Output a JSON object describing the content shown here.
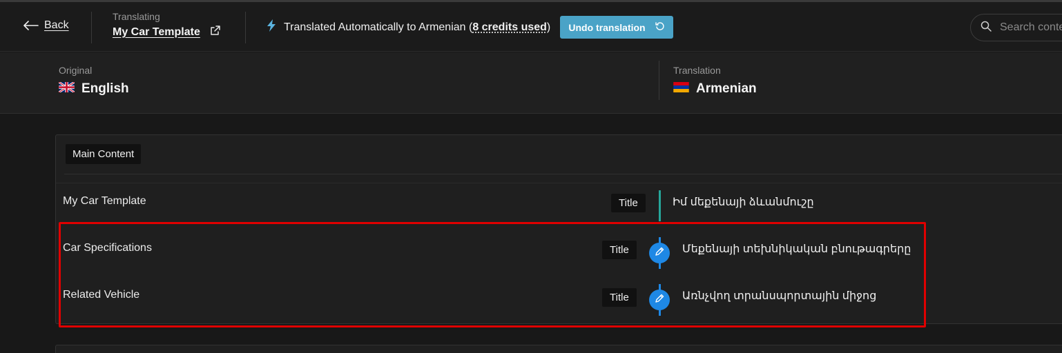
{
  "header": {
    "back_label": "Back",
    "translating_label": "Translating",
    "document_title": "My Car Template",
    "status_text": "Translated Automatically to Armenian (",
    "status_credits": "8 credits used",
    "status_close": ")",
    "undo_label": "Undo translation",
    "search_placeholder": "Search content"
  },
  "languages": {
    "original_label": "Original",
    "original_name": "English",
    "translation_label": "Translation",
    "translation_name": "Armenian"
  },
  "section": {
    "label": "Main Content",
    "rows": [
      {
        "source": "My Car Template",
        "type": "Title",
        "translation": "Իմ մեքենայի ձևանմուշը"
      },
      {
        "source": "Car Specifications",
        "type": "Title",
        "translation": "Մեքենայի տեխնիկական բնութագրերը"
      },
      {
        "source": "Related Vehicle",
        "type": "Title",
        "translation": "Առնչվող տրանսպորտային միջոց"
      }
    ]
  },
  "colors": {
    "accent_undo": "#4aa3c7",
    "edit_button": "#1e88e5",
    "bar_done": "#26a69a",
    "bar_editable": "#1e88e5",
    "highlight": "#e00000"
  },
  "icons": [
    "arrow-left-icon",
    "external-link-icon",
    "lightning-icon",
    "undo-icon",
    "search-icon",
    "uk-flag-icon",
    "armenia-flag-icon",
    "pencil-icon"
  ]
}
